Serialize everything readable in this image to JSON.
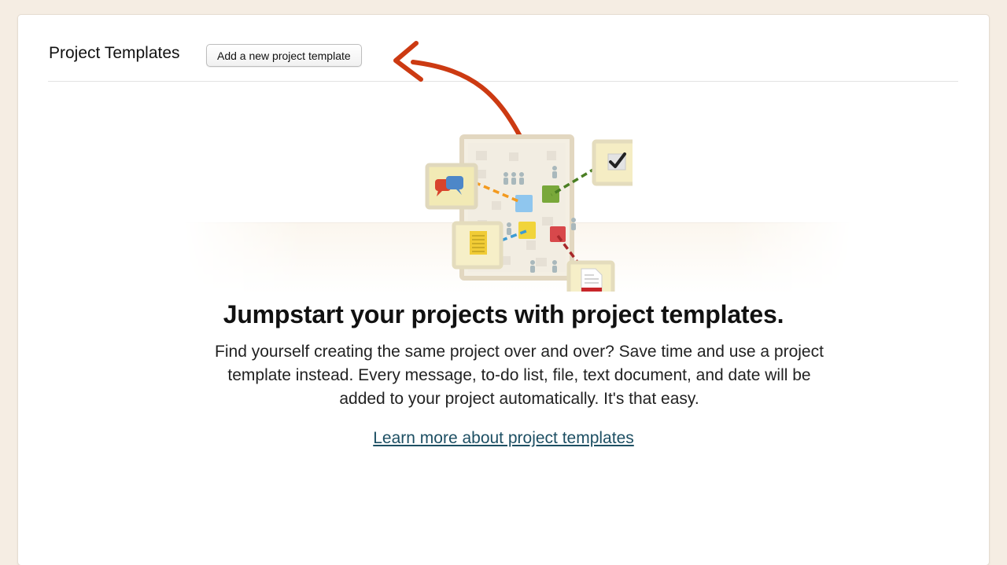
{
  "header": {
    "title": "Project Templates",
    "add_button_label": "Add a new project template"
  },
  "empty_state": {
    "headline": "Jumpstart your projects with project templates.",
    "description": "Find yourself creating the same project over and over? Save time and use a project template instead. Every message, to-do list, file, text document, and date will be added to your project automatically. It's that easy.",
    "link_label": "Learn more about project templates"
  },
  "colors": {
    "page_background": "#f5ede3",
    "arrow": "#cc3a12",
    "link": "#1d4f63"
  },
  "icons": {
    "arrow": "curved-arrow-icon",
    "illustration": "project-templates-illustration",
    "message": "speech-bubbles-icon",
    "todo": "checkmark-icon",
    "document": "text-document-icon",
    "file": "file-icon"
  }
}
